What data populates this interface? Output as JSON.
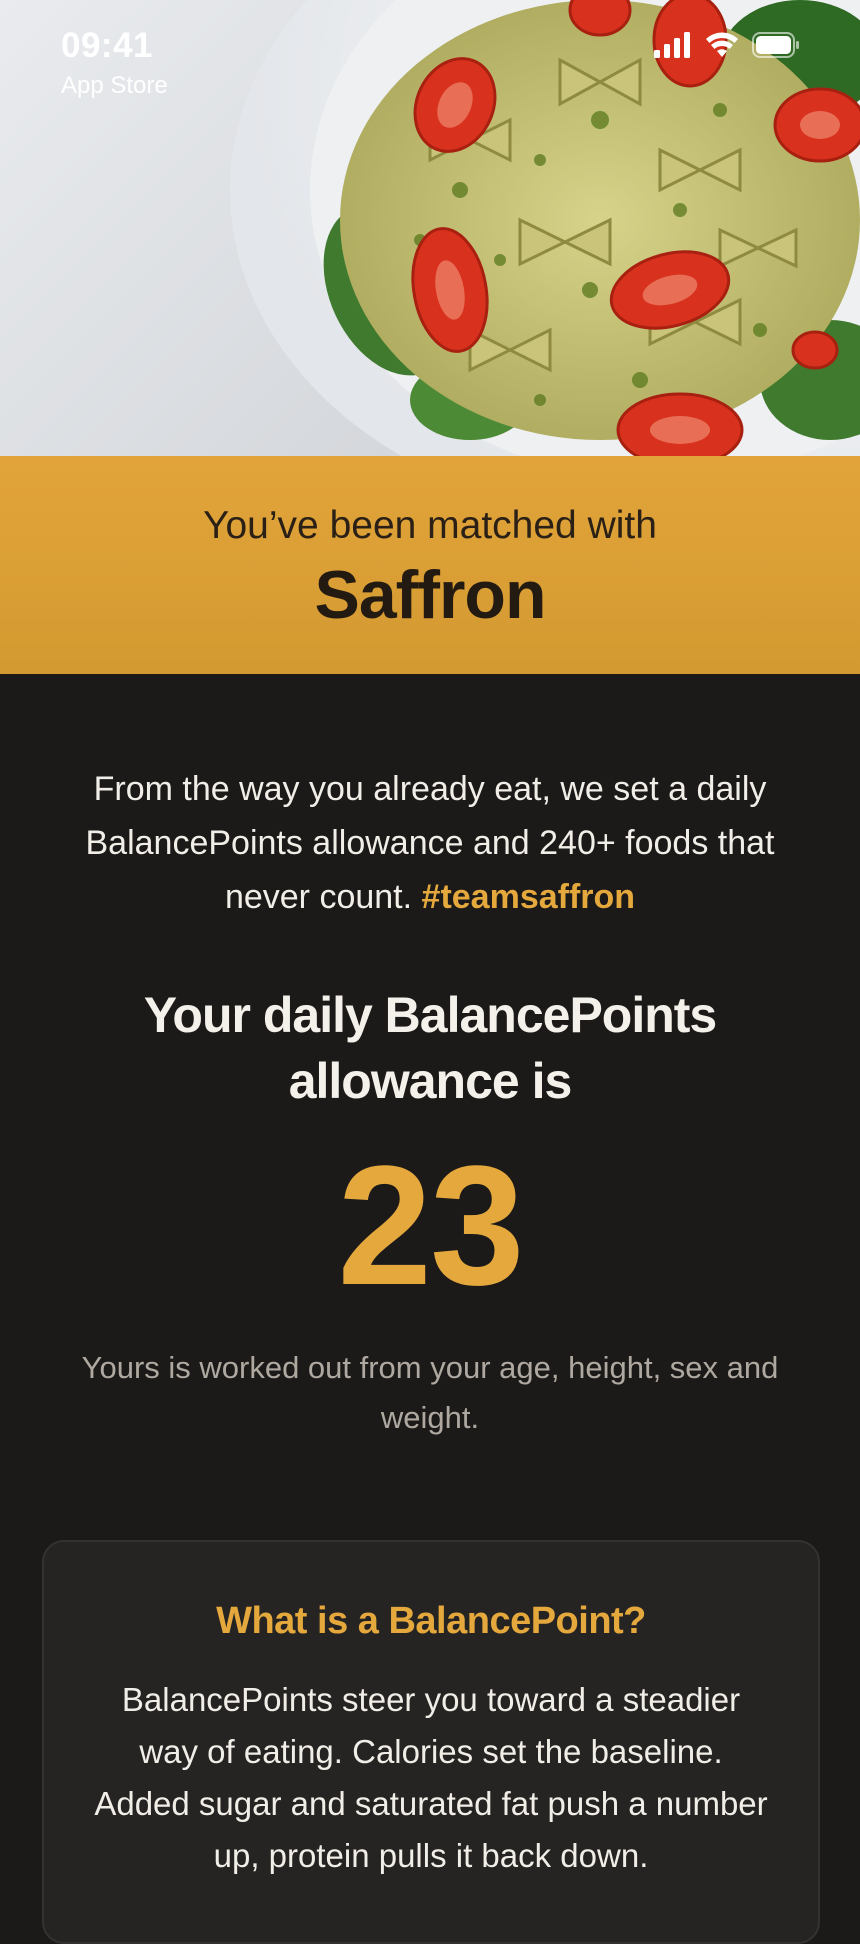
{
  "status_bar": {
    "time": "09:41",
    "back_app": "App Store"
  },
  "hero": {
    "image": "pasta-salad-photo"
  },
  "match": {
    "subtitle": "You’ve been matched with",
    "name": "Saffron"
  },
  "intro": {
    "text": "From the way you already eat, we set a daily BalancePoints allowance and 240+ foods that never count.",
    "hashtag": "#teamsaffron"
  },
  "allowance": {
    "heading": "Your daily BalancePoints allowance is",
    "value": "23",
    "note": "Yours is worked out from your age, height, sex and weight."
  },
  "info_card": {
    "title": "What is a BalancePoint?",
    "body": "BalancePoints steer you toward a steadier way of eating. Calories set the baseline. Added sugar and saturated fat push a number up, protein pulls it back down."
  },
  "colors": {
    "accent": "#e4a83d",
    "banner": "#dea23a",
    "background": "#1c1a19",
    "card": "#262422"
  }
}
